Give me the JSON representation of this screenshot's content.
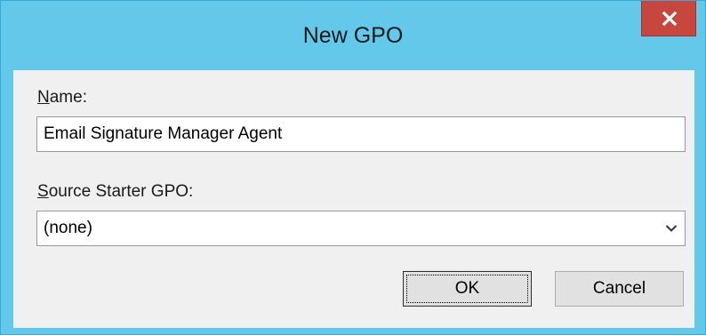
{
  "window": {
    "title": "New GPO",
    "close_glyph": "x"
  },
  "form": {
    "name_label_mnemonic": "N",
    "name_label_rest": "ame:",
    "name_value": "Email Signature Manager Agent",
    "starter_label_mnemonic": "S",
    "starter_label_rest": "ource Starter GPO:",
    "starter_value": "(none)"
  },
  "buttons": {
    "ok_label": "OK",
    "cancel_label": "Cancel"
  },
  "colors": {
    "titlebar": "#64c8ea",
    "close_button": "#c7463e",
    "client_background": "#f0f0f0"
  },
  "icons": {
    "close": "close-icon",
    "dropdown": "chevron-down-icon"
  }
}
